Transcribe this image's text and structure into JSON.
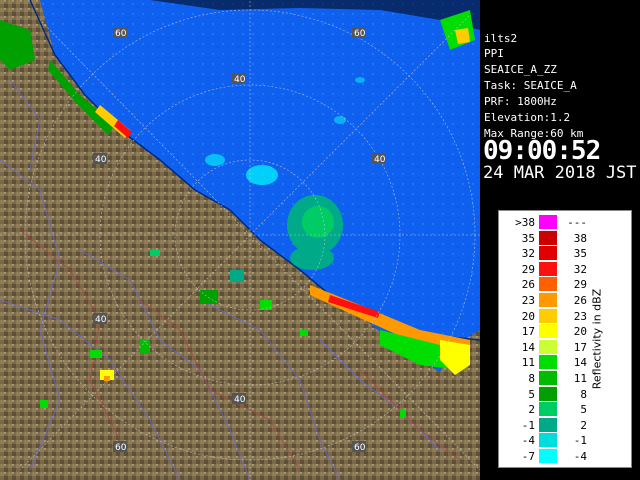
{
  "info": {
    "site": "ilts2",
    "mode": "PPI",
    "product": "SEAICE_A_ZZ",
    "task": "Task: SEAICE_A",
    "prf": "PRF: 1800Hz",
    "elevation": "Elevation:1.2",
    "max_range": "Max Range:60 km",
    "time": "09:00:52",
    "date": "24 MAR 2018 JST"
  },
  "legend": {
    "title": "Reflectivity in dBZ",
    "rows": [
      {
        "lo": ">38",
        "hi": "---",
        "color": "#ff00ff"
      },
      {
        "lo": "35",
        "hi": "38",
        "color": "#cc0000"
      },
      {
        "lo": "32",
        "hi": "35",
        "color": "#e00000"
      },
      {
        "lo": "29",
        "hi": "32",
        "color": "#ff1010"
      },
      {
        "lo": "26",
        "hi": "29",
        "color": "#ff6000"
      },
      {
        "lo": "23",
        "hi": "26",
        "color": "#ff9900"
      },
      {
        "lo": "20",
        "hi": "23",
        "color": "#ffcc00"
      },
      {
        "lo": "17",
        "hi": "20",
        "color": "#ffff00"
      },
      {
        "lo": "14",
        "hi": "17",
        "color": "#ccff33"
      },
      {
        "lo": "11",
        "hi": "14",
        "color": "#00dd00"
      },
      {
        "lo": "8",
        "hi": "11",
        "color": "#00bb00"
      },
      {
        "lo": "5",
        "hi": "8",
        "color": "#00a000"
      },
      {
        "lo": "2",
        "hi": "5",
        "color": "#00cc66"
      },
      {
        "lo": "-1",
        "hi": "2",
        "color": "#00aa88"
      },
      {
        "lo": "-4",
        "hi": "-1",
        "color": "#00dddd"
      },
      {
        "lo": "-7",
        "hi": "-4",
        "color": "#00ffff"
      }
    ]
  },
  "map": {
    "range_ring_labels": [
      "40",
      "40",
      "40",
      "40",
      "40",
      "60",
      "60",
      "60",
      "60"
    ],
    "sea_color": "#1060f0",
    "land_color": "#7a6a4a"
  }
}
